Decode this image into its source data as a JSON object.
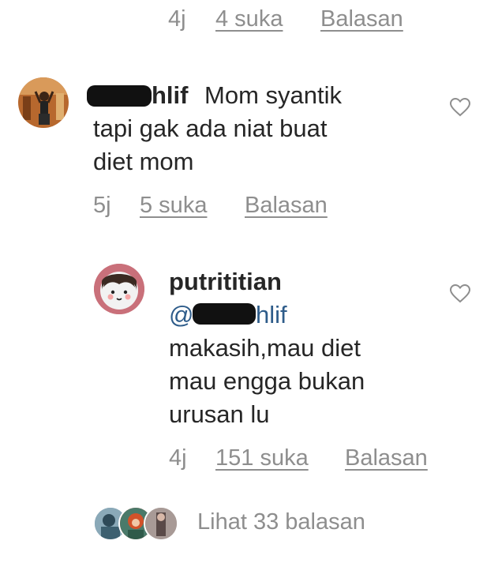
{
  "top_meta": {
    "time": "4j",
    "likes": "4 suka",
    "reply": "Balasan"
  },
  "comment1": {
    "username_visible": "hlif",
    "text_line1": "Mom syantik",
    "text_line2": "tapi gak ada niat buat",
    "text_line3": "diet mom",
    "time": "5j",
    "likes": "5 suka",
    "reply": "Balasan",
    "like_icon": "heart-outline-icon"
  },
  "reply1": {
    "username": "putrititian",
    "mention_prefix": "@",
    "mention_visible": "hlif",
    "text_line1": "makasih,mau diet",
    "text_line2": "mau engga bukan",
    "text_line3": "urusan lu",
    "time": "4j",
    "likes": "151 suka",
    "reply": "Balasan",
    "like_icon": "heart-outline-icon"
  },
  "view_replies": {
    "label": "Lihat 33 balasan"
  },
  "colors": {
    "text": "#262626",
    "meta": "#8e8e8e",
    "mention": "#2e5c8a",
    "background": "#ffffff"
  }
}
